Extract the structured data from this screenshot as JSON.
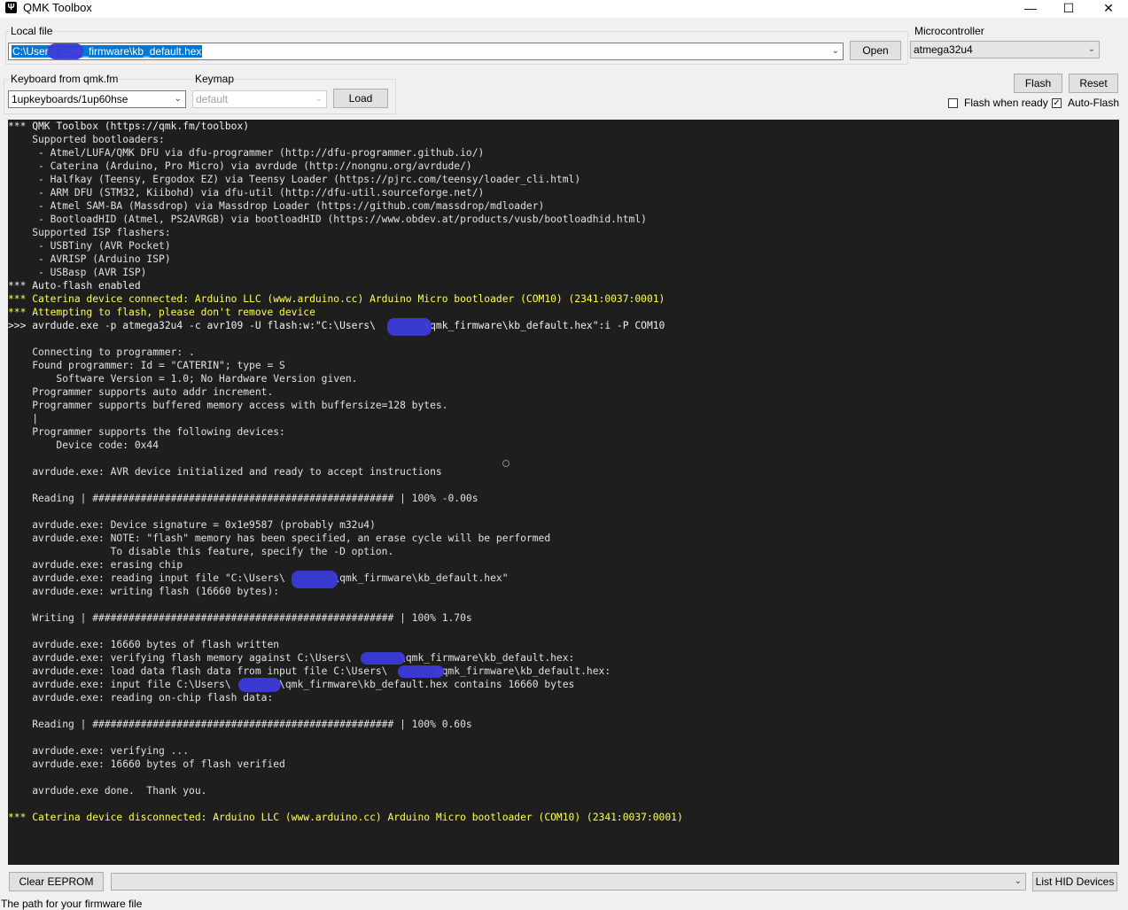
{
  "window": {
    "title": "QMK Toolbox",
    "minimize": "—",
    "maximize": "☐",
    "close": "✕"
  },
  "local_file": {
    "group_label": "Local file",
    "value": "C:\\Users\\        \\qmk_firmware\\kb_default.hex",
    "open_label": "Open"
  },
  "microcontroller": {
    "group_label": "Microcontroller",
    "value": "atmega32u4"
  },
  "keyboard": {
    "group_label": "Keyboard from qmk.fm",
    "value": "1upkeyboards/1up60hse",
    "keymap_label": "Keymap",
    "keymap_value": "default",
    "load_label": "Load"
  },
  "actions": {
    "flash_label": "Flash",
    "reset_label": "Reset",
    "flash_when_ready_label": "Flash when ready",
    "flash_when_ready_checked": false,
    "auto_flash_label": "Auto-Flash",
    "auto_flash_checked": true
  },
  "console": {
    "lines": [
      {
        "text": "*** QMK Toolbox (https://qmk.fm/toolbox)",
        "style": "white"
      },
      {
        "text": "    Supported bootloaders:",
        "style": "normal"
      },
      {
        "text": "     - Atmel/LUFA/QMK DFU via dfu-programmer (http://dfu-programmer.github.io/)",
        "style": "normal"
      },
      {
        "text": "     - Caterina (Arduino, Pro Micro) via avrdude (http://nongnu.org/avrdude/)",
        "style": "normal"
      },
      {
        "text": "     - Halfkay (Teensy, Ergodox EZ) via Teensy Loader (https://pjrc.com/teensy/loader_cli.html)",
        "style": "normal"
      },
      {
        "text": "     - ARM DFU (STM32, Kiibohd) via dfu-util (http://dfu-util.sourceforge.net/)",
        "style": "normal"
      },
      {
        "text": "     - Atmel SAM-BA (Massdrop) via Massdrop Loader (https://github.com/massdrop/mdloader)",
        "style": "normal"
      },
      {
        "text": "     - BootloadHID (Atmel, PS2AVRGB) via bootloadHID (https://www.obdev.at/products/vusb/bootloadhid.html)",
        "style": "normal"
      },
      {
        "text": "    Supported ISP flashers:",
        "style": "normal"
      },
      {
        "text": "     - USBTiny (AVR Pocket)",
        "style": "normal"
      },
      {
        "text": "     - AVRISP (Arduino ISP)",
        "style": "normal"
      },
      {
        "text": "     - USBasp (AVR ISP)",
        "style": "normal"
      },
      {
        "text": "*** Auto-flash enabled",
        "style": "white"
      },
      {
        "text": "*** Caterina device connected: Arduino LLC (www.arduino.cc) Arduino Micro bootloader (COM10) (2341:0037:0001)",
        "style": "yellow"
      },
      {
        "text": "*** Attempting to flash, please don't remove device",
        "style": "yellow"
      },
      {
        "text": ">>> avrdude.exe -p atmega32u4 -c avr109 -U flash:w:\"C:\\Users\\        \\qmk_firmware\\kb_default.hex\":i -P COM10",
        "style": "white"
      },
      {
        "text": "",
        "style": "normal"
      },
      {
        "text": "    Connecting to programmer: .",
        "style": "normal"
      },
      {
        "text": "    Found programmer: Id = \"CATERIN\"; type = S",
        "style": "normal"
      },
      {
        "text": "        Software Version = 1.0; No Hardware Version given.",
        "style": "normal"
      },
      {
        "text": "    Programmer supports auto addr increment.",
        "style": "normal"
      },
      {
        "text": "    Programmer supports buffered memory access with buffersize=128 bytes.",
        "style": "normal"
      },
      {
        "text": "    |",
        "style": "normal"
      },
      {
        "text": "    Programmer supports the following devices:",
        "style": "normal"
      },
      {
        "text": "        Device code: 0x44",
        "style": "normal"
      },
      {
        "text": "",
        "style": "normal"
      },
      {
        "text": "    avrdude.exe: AVR device initialized and ready to accept instructions",
        "style": "normal"
      },
      {
        "text": "",
        "style": "normal"
      },
      {
        "text": "    Reading | ################################################## | 100% -0.00s",
        "style": "normal"
      },
      {
        "text": "",
        "style": "normal"
      },
      {
        "text": "    avrdude.exe: Device signature = 0x1e9587 (probably m32u4)",
        "style": "normal"
      },
      {
        "text": "    avrdude.exe: NOTE: \"flash\" memory has been specified, an erase cycle will be performed",
        "style": "normal"
      },
      {
        "text": "                 To disable this feature, specify the -D option.",
        "style": "normal"
      },
      {
        "text": "    avrdude.exe: erasing chip",
        "style": "normal"
      },
      {
        "text": "    avrdude.exe: reading input file \"C:\\Users\\        \\qmk_firmware\\kb_default.hex\"",
        "style": "normal"
      },
      {
        "text": "    avrdude.exe: writing flash (16660 bytes):",
        "style": "normal"
      },
      {
        "text": "",
        "style": "normal"
      },
      {
        "text": "    Writing | ################################################## | 100% 1.70s",
        "style": "normal"
      },
      {
        "text": "",
        "style": "normal"
      },
      {
        "text": "    avrdude.exe: 16660 bytes of flash written",
        "style": "normal"
      },
      {
        "text": "    avrdude.exe: verifying flash memory against C:\\Users\\        \\qmk_firmware\\kb_default.hex:",
        "style": "normal"
      },
      {
        "text": "    avrdude.exe: load data flash data from input file C:\\Users\\        \\qmk_firmware\\kb_default.hex:",
        "style": "normal"
      },
      {
        "text": "    avrdude.exe: input file C:\\Users\\        \\qmk_firmware\\kb_default.hex contains 16660 bytes",
        "style": "normal"
      },
      {
        "text": "    avrdude.exe: reading on-chip flash data:",
        "style": "normal"
      },
      {
        "text": "",
        "style": "normal"
      },
      {
        "text": "    Reading | ################################################## | 100% 0.60s",
        "style": "normal"
      },
      {
        "text": "",
        "style": "normal"
      },
      {
        "text": "    avrdude.exe: verifying ...",
        "style": "normal"
      },
      {
        "text": "    avrdude.exe: 16660 bytes of flash verified",
        "style": "normal"
      },
      {
        "text": "",
        "style": "normal"
      },
      {
        "text": "    avrdude.exe done.  Thank you.",
        "style": "normal"
      },
      {
        "text": "",
        "style": "normal"
      },
      {
        "text": "*** Caterina device disconnected: Arduino LLC (www.arduino.cc) Arduino Micro bootloader (COM10) (2341:0037:0001)",
        "style": "yellow"
      }
    ]
  },
  "bottom": {
    "clear_eeprom_label": "Clear EEPROM",
    "hid_select_value": "",
    "list_hid_label": "List HID Devices"
  },
  "status_text": "The path for your firmware file",
  "colors": {
    "console_bg": "#1e1e1e",
    "console_text": "#e0e0e0",
    "highlight": "#ffff4d",
    "selection": "#0078d7",
    "redaction": "#3b3bd9"
  }
}
